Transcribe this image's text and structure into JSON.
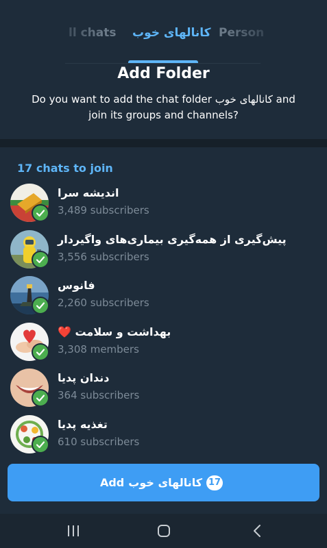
{
  "tabs": {
    "left": "ll chats",
    "center": "کانالهای خوب",
    "right": "Person"
  },
  "dialog": {
    "title": "Add Folder",
    "subtitle": "Do you want to add the chat folder کانالهای خوب and join its groups and channels?"
  },
  "section_label": "17 chats to join",
  "chats": [
    {
      "name": "اندیشه سرا",
      "sub": "3,489 subscribers",
      "avatar_icon": "book-avatar-icon"
    },
    {
      "name": "پیش‌گیری از همه‌گیری بیماری‌های واگیردار",
      "sub": "3,556 subscribers",
      "avatar_icon": "hazmat-avatar-icon"
    },
    {
      "name": "فانوس",
      "sub": "2,260 subscribers",
      "avatar_icon": "lighthouse-avatar-icon"
    },
    {
      "name": "بهداشت و سلامت ❤️",
      "sub": "3,308 members",
      "avatar_icon": "heart-hands-avatar-icon"
    },
    {
      "name": "دندان پدیا",
      "sub": "364 subscribers",
      "avatar_icon": "smile-avatar-icon"
    },
    {
      "name": "تغذیه پدیا",
      "sub": "610 subscribers",
      "avatar_icon": "nutrition-avatar-icon"
    }
  ],
  "add_button": {
    "prefix": "Add",
    "folder": "کانالهای خوب",
    "count": "17"
  },
  "colors": {
    "accent": "#5eb5f7",
    "button": "#3e9df4",
    "check": "#4cae4f",
    "background": "#1e2c3a"
  }
}
